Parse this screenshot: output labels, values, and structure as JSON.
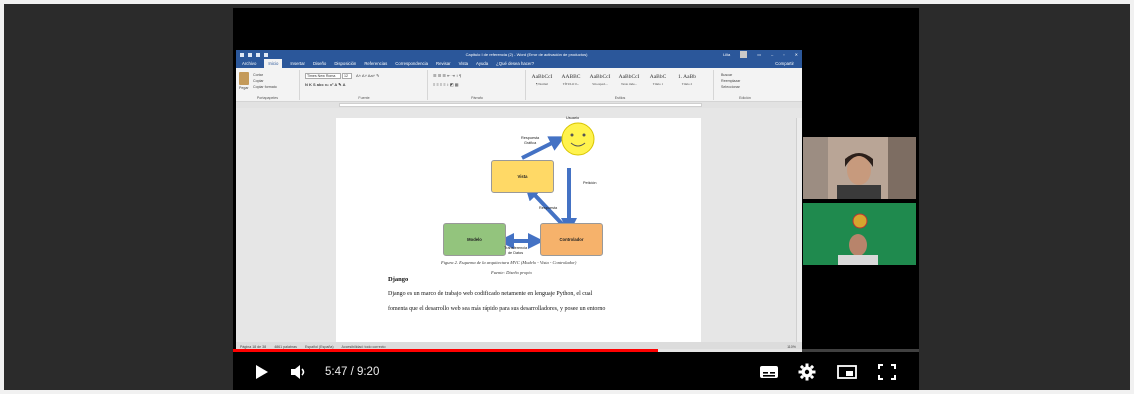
{
  "word": {
    "title": "Capitulo I de referencia (2)  -  Word (Error de activación de productos)",
    "user": "Lilia",
    "tabs": [
      "Archivo",
      "Inicio",
      "Insertar",
      "Diseño",
      "Disposición",
      "Referencias",
      "Correspondencia",
      "Revisar",
      "Vista",
      "Ayuda",
      "¿Qué desea hacer?"
    ],
    "active_tab": "Inicio",
    "share_label": "Compartir",
    "groups": {
      "clipboard": {
        "label": "Portapapeles",
        "paste": "Pegar",
        "cut": "Cortar",
        "copy": "Copiar",
        "format_painter": "Copiar formato"
      },
      "font": {
        "label": "Fuente",
        "font_name": "Times New Roma",
        "font_size": "12"
      },
      "paragraph": {
        "label": "Párrafo"
      },
      "styles": {
        "label": "Estilos",
        "items": [
          {
            "sample": "AaBbCcI",
            "name": "¶ Normal"
          },
          {
            "sample": "AABBC",
            "name": "TÍTULO 0..."
          },
          {
            "sample": "AaBbCcI",
            "name": "Sin espaci..."
          },
          {
            "sample": "AaBbCcI",
            "name": "Texto inde..."
          },
          {
            "sample": "AaBbC",
            "name": "Título 1"
          },
          {
            "sample": "1. AaBb",
            "name": "Título 2"
          }
        ]
      },
      "editing": {
        "label": "Edición",
        "find": "Buscar",
        "replace": "Reemplazar",
        "select": "Seleccionar"
      }
    },
    "diagram": {
      "usuario": "Usuario",
      "vista": "Vista",
      "modelo": "Modelo",
      "controlador": "Controlador",
      "respuesta_grafica": "Respuesta\nGráfica",
      "peticion": "Petición",
      "respuesta": "Respuesta",
      "transferencia": "Transferencia\nde Datos"
    },
    "caption": "Figura 2. Esquema de la arquitectura MVC (Modelo - Vista - Controlador)",
    "source": "Fuente: Diseño propio",
    "heading": "Django",
    "paragraph_lines": [
      "Django es un marco de trabajo web codificado netamente en lenguaje Python, el cual",
      "fomenta que el desarrollo web sea más rápido para sus desarrolladores, y posee un entorno"
    ],
    "status": {
      "page": "Página 18 de 38",
      "words": "4861 palabras",
      "language": "Español (España)",
      "accessibility": "Accesibilidad: todo correcto",
      "zoom": "110%"
    }
  },
  "player": {
    "current_time": "5:47",
    "duration": "9:20",
    "time_text": "5:47 / 9:20",
    "progress_fraction": 0.62,
    "accent": "#ff0000"
  }
}
